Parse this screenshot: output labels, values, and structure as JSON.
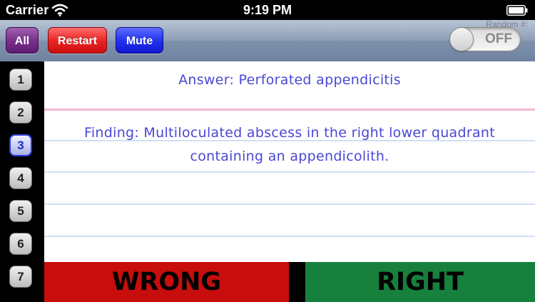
{
  "status_bar": {
    "carrier": "Carrier",
    "time": "9:19 PM",
    "wifi_icon": "wifi-icon",
    "battery_icon": "battery-icon"
  },
  "toolbar": {
    "all_label": "All",
    "restart_label": "Restart",
    "mute_label": "Mute",
    "random_label": "Random #:",
    "random_toggle": "OFF"
  },
  "card_numbers": [
    {
      "label": "1",
      "selected": false
    },
    {
      "label": "2",
      "selected": false
    },
    {
      "label": "3",
      "selected": true
    },
    {
      "label": "4",
      "selected": false
    },
    {
      "label": "5",
      "selected": false
    },
    {
      "label": "6",
      "selected": false
    },
    {
      "label": "7",
      "selected": false
    }
  ],
  "card": {
    "answer": "Answer: Perforated appendicitis",
    "finding": "Finding: Multiloculated abscess in the right lower quadrant containing an appendicolith."
  },
  "grading": {
    "wrong_label": "WRONG",
    "right_label": "RIGHT"
  },
  "colors": {
    "wrong": "#c80d0d",
    "right": "#16803c",
    "card_text": "#4a47d6",
    "all_button": "#7a2f8c",
    "restart_button": "#ec2525",
    "mute_button": "#2233ee"
  }
}
